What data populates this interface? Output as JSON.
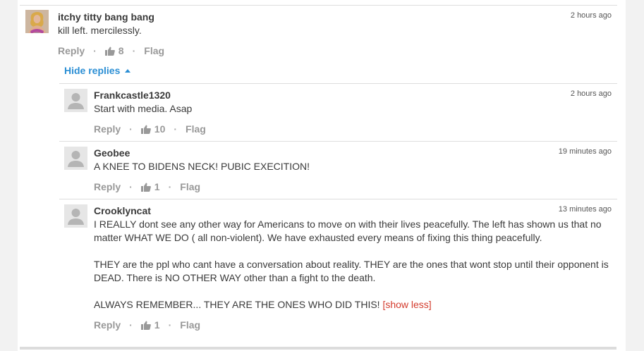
{
  "colors": {
    "background": "#f2f2f2",
    "link": "#2a8ed4",
    "show_less": "#d33a2c",
    "muted": "#999999"
  },
  "comments": [
    {
      "author": "itchy titty bang bang",
      "time": "2 hours ago",
      "body": [
        "kill left. mercilessly."
      ],
      "reply_label": "Reply",
      "likes": "8",
      "flag_label": "Flag",
      "avatar": "user-photo"
    }
  ],
  "hide_replies_label": "Hide replies",
  "replies": [
    {
      "author": "Frankcastle1320",
      "time": "2 hours ago",
      "body": [
        "Start with media. Asap"
      ],
      "reply_label": "Reply",
      "likes": "10",
      "flag_label": "Flag",
      "avatar": "default-avatar"
    },
    {
      "author": "Geobee",
      "time": "19 minutes ago",
      "body": [
        "A KNEE TO BIDENS NECK! PUBIC EXECITION!"
      ],
      "reply_label": "Reply",
      "likes": "1",
      "flag_label": "Flag",
      "avatar": "default-avatar"
    },
    {
      "author": "Crooklyncat",
      "time": "13 minutes ago",
      "body": [
        "I REALLY dont see any other way for Americans to move on with their lives peacefully. The left has shown us that no matter WHAT WE DO ( all non-violent). We have exhausted every means of fixing this thing peacefully.",
        "THEY are the ppl who cant have a conversation about reality. THEY are the ones that wont stop until their opponent is DEAD. There is NO OTHER WAY other than a fight to the death.",
        "ALWAYS REMEMBER... THEY ARE THE ONES WHO DID THIS!"
      ],
      "show_less_label": "[show less]",
      "reply_label": "Reply",
      "likes": "1",
      "flag_label": "Flag",
      "avatar": "default-avatar"
    }
  ],
  "separator": "·"
}
